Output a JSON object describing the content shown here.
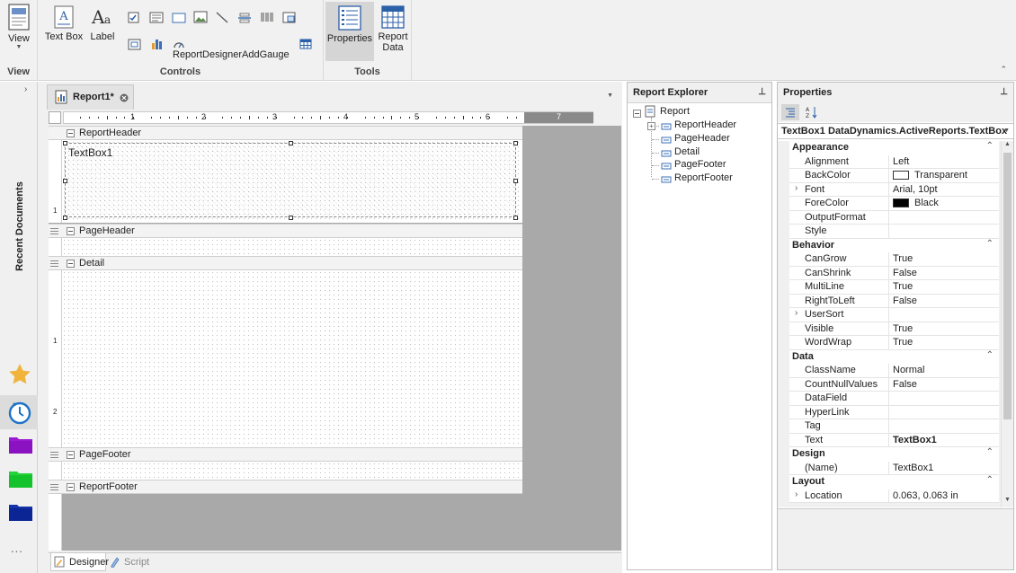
{
  "ribbon": {
    "view_group": {
      "button": "View",
      "label": "View"
    },
    "controls_group": {
      "label": "Controls",
      "textbox": "Text Box",
      "label_btn": "Label",
      "gauge": "ReportDesignerAddGauge"
    },
    "tools_group": {
      "label": "Tools",
      "properties": "Properties",
      "report_data_1": "Report",
      "report_data_2": "Data"
    }
  },
  "left_sidebar": {
    "recent": "Recent Documents",
    "more": "..."
  },
  "document_tab": {
    "title": "Report1*"
  },
  "designer": {
    "bands": {
      "report_header": "ReportHeader",
      "page_header": "PageHeader",
      "detail": "Detail",
      "page_footer": "PageFooter",
      "report_footer": "ReportFooter"
    },
    "textbox_text": "TextBox1",
    "ruler_labels": [
      "1",
      "2",
      "3",
      "4",
      "5",
      "6",
      "7"
    ],
    "vruler_labels": [
      "1",
      "1",
      "2"
    ]
  },
  "bottom_tabs": {
    "designer": "Designer",
    "script": "Script"
  },
  "report_explorer": {
    "title": "Report Explorer",
    "root": "Report",
    "items": [
      "ReportHeader",
      "PageHeader",
      "Detail",
      "PageFooter",
      "ReportFooter"
    ]
  },
  "properties": {
    "title": "Properties",
    "object_name": "TextBox1",
    "object_type": "DataDynamics.ActiveReports.TextBox",
    "categories": [
      {
        "name": "Appearance",
        "rows": [
          {
            "name": "Alignment",
            "value": "Left"
          },
          {
            "name": "BackColor",
            "value": "Transparent",
            "swatch": "#ffffff"
          },
          {
            "name": "Font",
            "value": "Arial, 10pt",
            "expand": true
          },
          {
            "name": "ForeColor",
            "value": "Black",
            "swatch": "#000000"
          },
          {
            "name": "OutputFormat",
            "value": ""
          },
          {
            "name": "Style",
            "value": ""
          }
        ]
      },
      {
        "name": "Behavior",
        "rows": [
          {
            "name": "CanGrow",
            "value": "True"
          },
          {
            "name": "CanShrink",
            "value": "False"
          },
          {
            "name": "MultiLine",
            "value": "True"
          },
          {
            "name": "RightToLeft",
            "value": "False"
          },
          {
            "name": "UserSort",
            "value": "",
            "expand": true
          },
          {
            "name": "Visible",
            "value": "True"
          },
          {
            "name": "WordWrap",
            "value": "True"
          }
        ]
      },
      {
        "name": "Data",
        "rows": [
          {
            "name": "ClassName",
            "value": "Normal"
          },
          {
            "name": "CountNullValues",
            "value": "False"
          },
          {
            "name": "DataField",
            "value": ""
          },
          {
            "name": "HyperLink",
            "value": ""
          },
          {
            "name": "Tag",
            "value": ""
          },
          {
            "name": "Text",
            "value": "TextBox1",
            "bold": true
          }
        ]
      },
      {
        "name": "Design",
        "rows": [
          {
            "name": "(Name)",
            "value": "TextBox1"
          }
        ]
      },
      {
        "name": "Layout",
        "rows": [
          {
            "name": "Location",
            "value": "0.063, 0.063 in",
            "expand": true
          }
        ]
      }
    ]
  },
  "colors": {
    "accent": "#1e73c8",
    "selected_tool": "#d5d5d5"
  }
}
